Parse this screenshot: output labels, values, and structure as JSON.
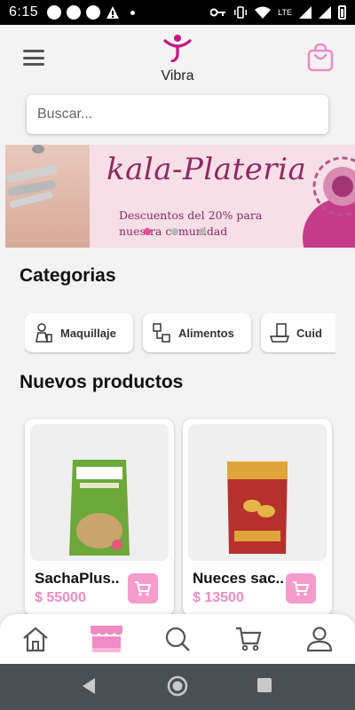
{
  "status_bar": {
    "time": "6:15",
    "network": "LTE"
  },
  "header": {
    "brand": "Vibra"
  },
  "search": {
    "placeholder": "Buscar..."
  },
  "banner": {
    "title": "kala-Plateria",
    "subtitle_line1": "Descuentos del 20% para",
    "subtitle_line2": "nuestra comunidad",
    "slides_total": 3,
    "active_slide": 1
  },
  "categories": {
    "heading": "Categorias",
    "items": [
      {
        "label": "Maquillaje",
        "icon": "makeup-icon"
      },
      {
        "label": "Alimentos",
        "icon": "food-icon"
      },
      {
        "label": "Cuid",
        "icon": "care-icon"
      }
    ]
  },
  "products": {
    "heading": "Nuevos productos",
    "items": [
      {
        "name": "SachaPlus..",
        "price": "$ 55000"
      },
      {
        "name": "Nueces sac..",
        "price": "$ 13500"
      }
    ]
  },
  "bottom_nav": {
    "items": [
      "home-icon",
      "store-icon",
      "search-icon",
      "cart-icon",
      "profile-icon"
    ],
    "active": "store-icon"
  },
  "colors": {
    "accent": "#f08cc3",
    "accent_button": "#f69ccd",
    "brand_magenta": "#c2187f",
    "banner_text": "#8e2a63"
  }
}
